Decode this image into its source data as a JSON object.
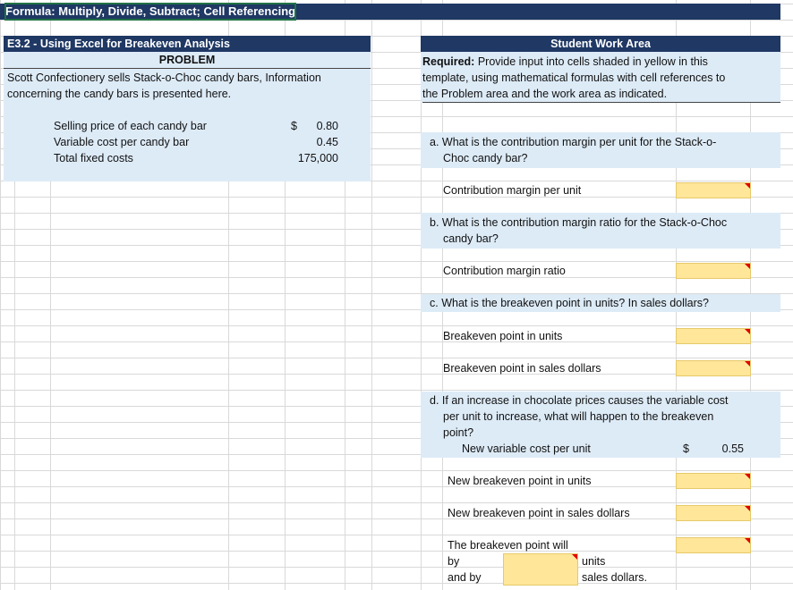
{
  "sheet": {
    "title": "Formula: Multiply, Divide, Subtract; Cell Referencing"
  },
  "problem": {
    "header": "E3.2 - Using Excel for Breakeven Analysis",
    "subheader": "PROBLEM",
    "description_line1": "Scott Confectionery sells Stack-o-Choc candy bars, Information",
    "description_line2": "concerning the candy bars is presented here.",
    "items": [
      {
        "label": "Selling price of each candy bar",
        "currency": "$",
        "value": "0.80"
      },
      {
        "label": "Variable cost per candy bar",
        "currency": "",
        "value": "0.45"
      },
      {
        "label": "Total fixed costs",
        "currency": "",
        "value": "175,000"
      }
    ]
  },
  "work": {
    "header": "Student Work Area",
    "required_bold": "Required:",
    "required_line1": " Provide input into cells shaded in yellow in this",
    "required_line2": "template, using mathematical formulas with cell references to",
    "required_line3": "the Problem area and the work area as indicated.",
    "q_a_line1": "a. What is the contribution margin per unit for the Stack-o-",
    "q_a_line2": "Choc candy bar?",
    "a_label": "Contribution margin per unit",
    "q_b_line1": "b. What is the contribution margin ratio for the Stack-o-Choc",
    "q_b_line2": "candy bar?",
    "b_label": "Contribution margin ratio",
    "q_c": "c. What is the breakeven point in units? In sales dollars?",
    "c_label1": "Breakeven point in units",
    "c_label2": "Breakeven point in sales dollars",
    "q_d_line1": "d. If an increase in chocolate prices causes the variable cost",
    "q_d_line2": "per unit to increase, what will happen to the breakeven",
    "q_d_line3": "point?",
    "d_newvc_label": "New variable cost per unit",
    "d_newvc_currency": "$",
    "d_newvc_value": "0.55",
    "d_label1": "New breakeven point in units",
    "d_label2": "New breakeven point in sales dollars",
    "d_will": "The breakeven point will",
    "d_by": "by",
    "d_units": "units",
    "d_andby": "and by",
    "d_sales": "sales dollars."
  }
}
